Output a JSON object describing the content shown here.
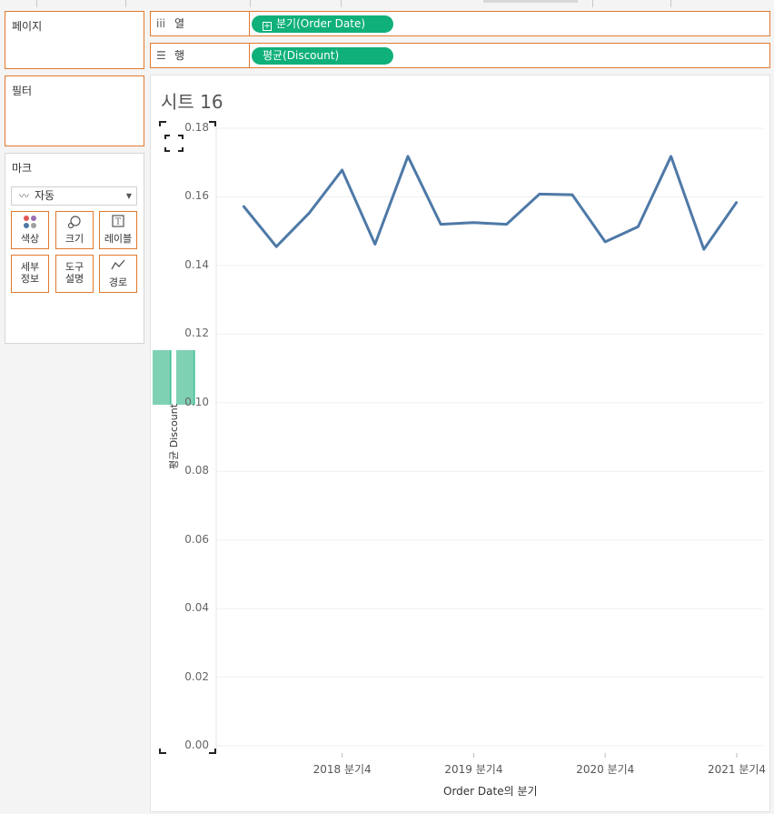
{
  "left_panels": {
    "pages_title": "페이지",
    "filters_title": "필터",
    "marks_title": "마크"
  },
  "marks": {
    "type_label": "자동",
    "type_icon": "line-icon",
    "buttons": [
      {
        "label": "색상",
        "icon": "color-dots-icon"
      },
      {
        "label": "크기",
        "icon": "size-icon"
      },
      {
        "label": "레이블",
        "icon": "label-icon"
      },
      {
        "label": "세부\n정보",
        "icon": "detail-icon"
      },
      {
        "label": "도구\n설명",
        "icon": "tooltip-icon"
      },
      {
        "label": "경로",
        "icon": "path-icon"
      }
    ]
  },
  "shelves": {
    "columns_label": "열",
    "columns_pill": "분기(Order Date)",
    "rows_label": "행",
    "rows_pill": "평균(Discount)"
  },
  "sheet": {
    "title": "시트 16"
  },
  "colors": {
    "line": "#4e79a7",
    "pill": "#0fb07a",
    "shelf_border": "#e07a2e"
  },
  "chart_data": {
    "type": "line",
    "title": "시트 16",
    "xlabel": "Order Date의 분기",
    "ylabel": "평균 Discount",
    "ylim": [
      0,
      0.18
    ],
    "y_ticks": [
      "0.00",
      "0.02",
      "0.04",
      "0.06",
      "0.08",
      "0.10",
      "0.12",
      "0.14",
      "0.16",
      "0.18"
    ],
    "x_ticks": [
      "2018 분기4",
      "2019 분기4",
      "2020 분기4",
      "2021 분기4"
    ],
    "x": [
      "2018 분기1",
      "2018 분기2",
      "2018 분기3",
      "2018 분기4",
      "2019 분기1",
      "2019 분기2",
      "2019 분기3",
      "2019 분기4",
      "2020 분기1",
      "2020 분기2",
      "2020 분기3",
      "2020 분기4",
      "2021 분기1",
      "2021 분기2",
      "2021 분기3",
      "2021 분기4"
    ],
    "series": [
      {
        "values": [
          0.1573,
          0.1455,
          0.1553,
          0.1678,
          0.1462,
          0.1718,
          0.152,
          0.1525,
          0.152,
          0.1608,
          0.1606,
          0.1469,
          0.1513,
          0.1718,
          0.1447,
          0.1585
        ]
      }
    ],
    "grid": true
  }
}
